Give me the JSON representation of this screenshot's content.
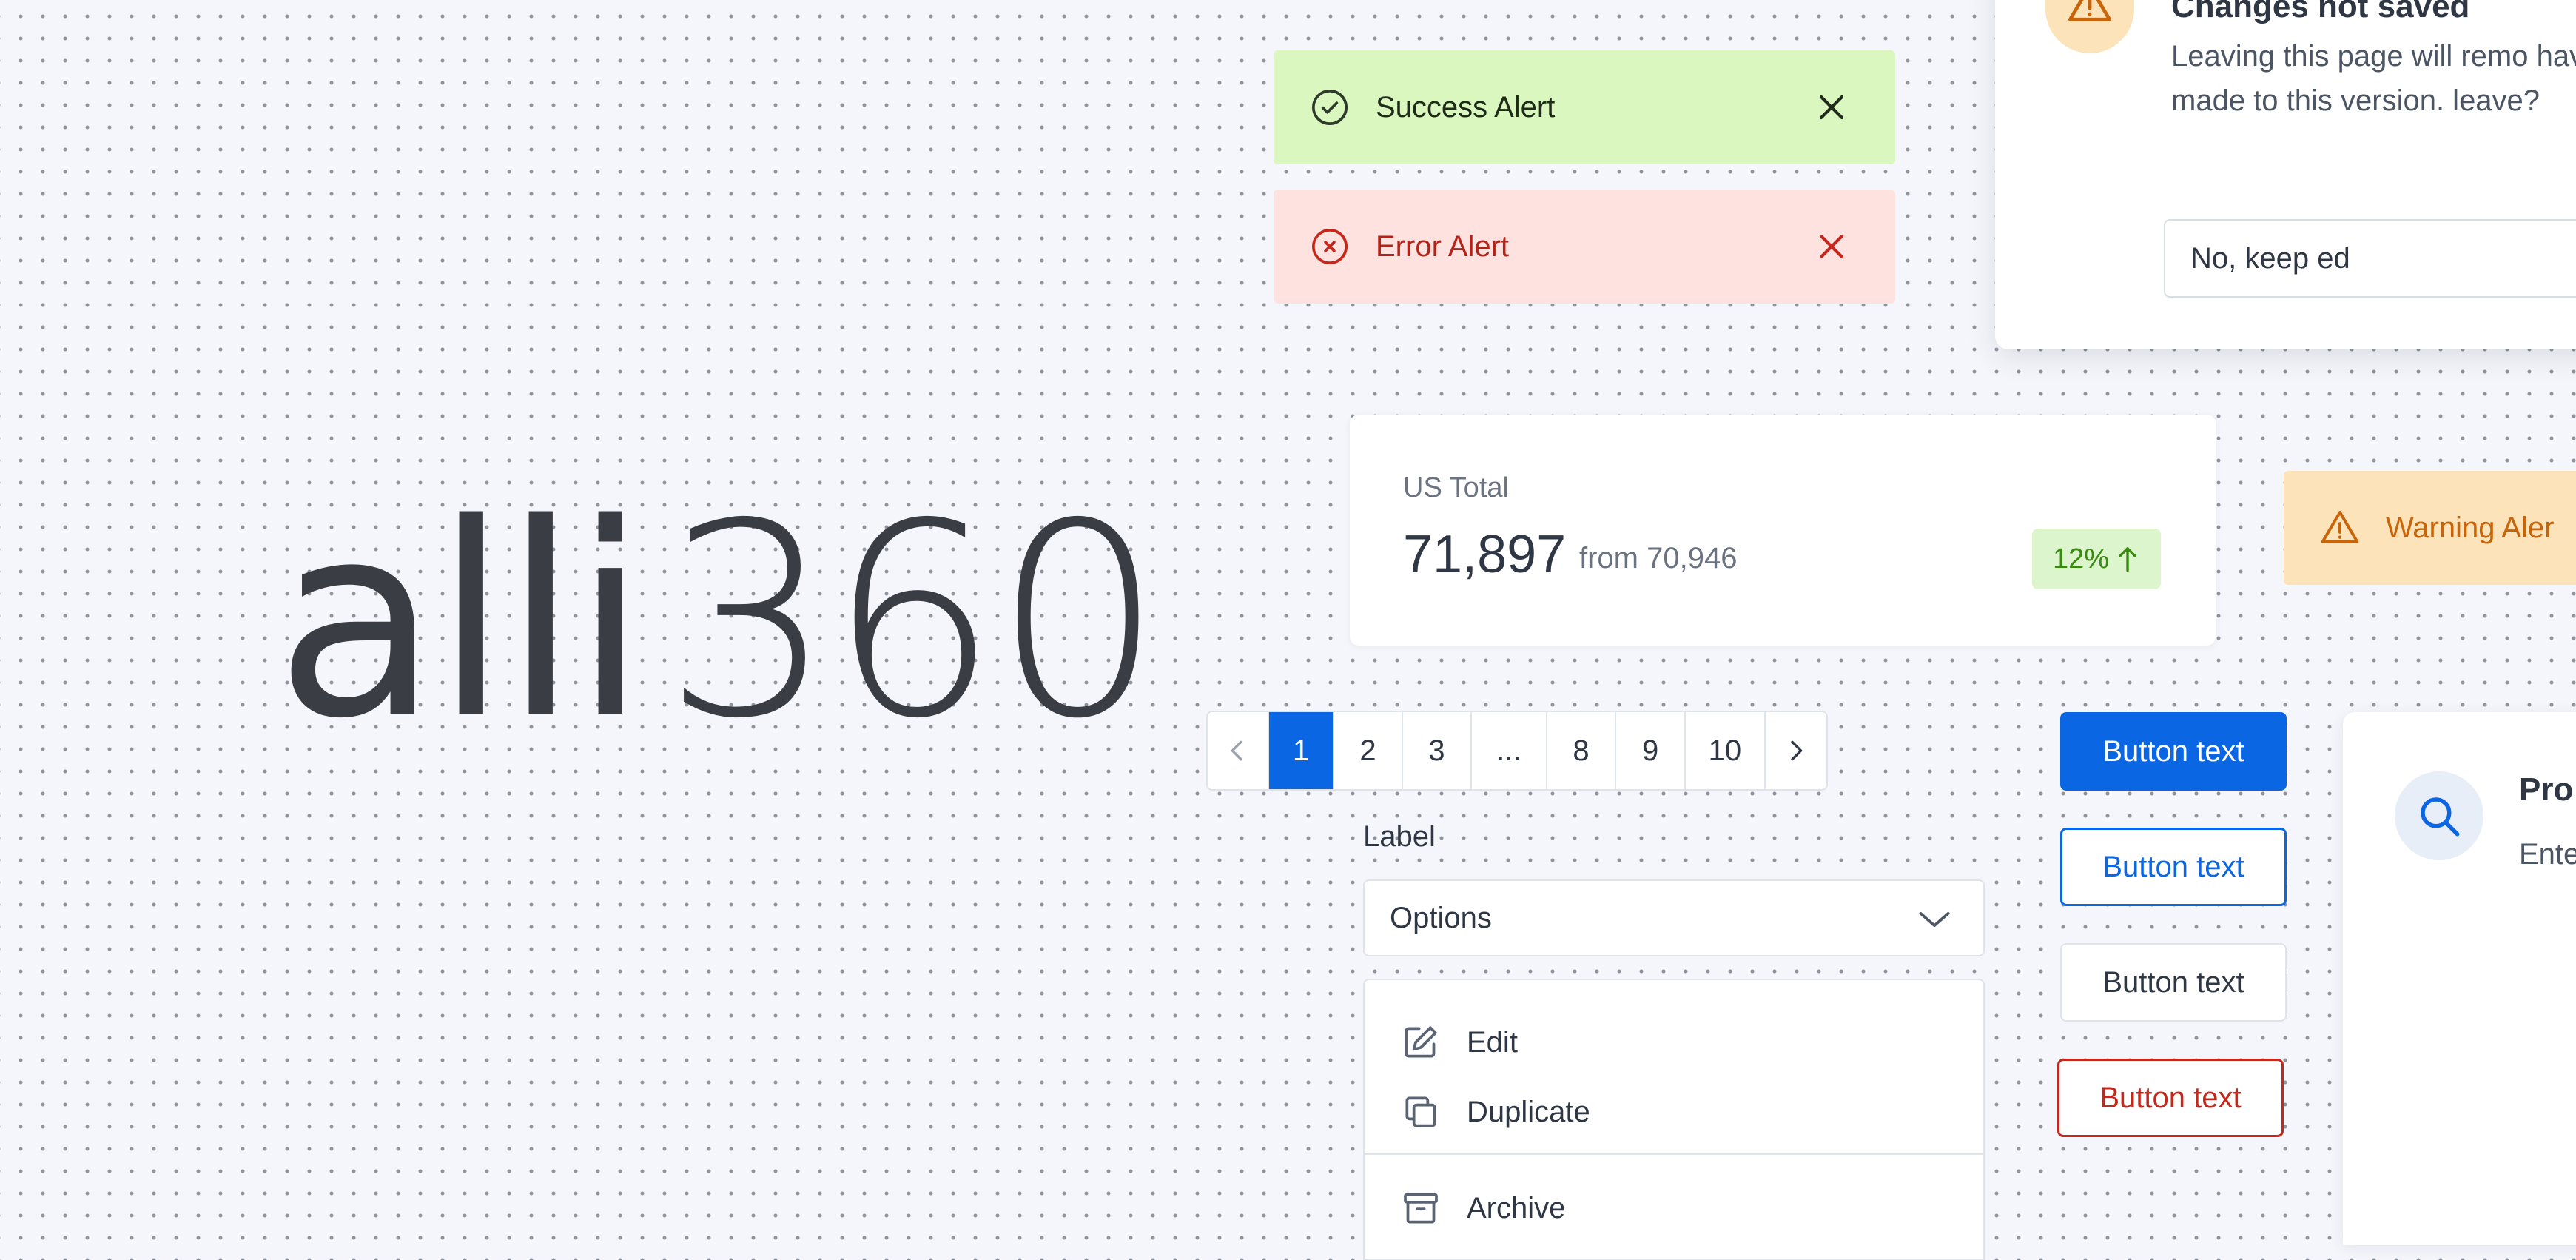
{
  "logo": {
    "word": "alli",
    "number": "360"
  },
  "alerts": {
    "success": {
      "text": "Success Alert",
      "icon": "check-circle-icon",
      "close_icon": "close-icon",
      "color": "#d9f7bf"
    },
    "error": {
      "text": "Error Alert",
      "icon": "x-circle-icon",
      "close_icon": "close-icon",
      "color": "#fde2df"
    },
    "warning": {
      "text": "Warning Aler",
      "icon": "warning-triangle-icon",
      "color": "#fde3b9"
    }
  },
  "modal": {
    "title": "Changes not saved",
    "body": "Leaving this page will remo have made to this version. leave?",
    "keep_button": "No, keep ed",
    "icon": "warning-triangle-icon"
  },
  "stat": {
    "label": "US Total",
    "value": "71,897",
    "from": "from 70,946",
    "change": "12%",
    "trend_icon": "arrow-up-icon",
    "trend_color": "#3a8a12"
  },
  "pagination": {
    "pages": [
      "1",
      "2",
      "3",
      "...",
      "8",
      "9",
      "10"
    ],
    "active": "1",
    "accent": "#0b66e4"
  },
  "field": {
    "label": "Label",
    "select_value": "Options"
  },
  "menu": {
    "items": [
      {
        "label": "Edit",
        "icon": "pencil-icon"
      },
      {
        "label": "Duplicate",
        "icon": "duplicate-icon"
      },
      {
        "label": "Archive",
        "icon": "archive-icon"
      }
    ]
  },
  "buttons": {
    "primary": "Button text",
    "outline": "Button text",
    "neutral": "Button text",
    "danger": "Button text"
  },
  "search_card": {
    "title": "Pro",
    "body": "Ente bar. mos as p",
    "icon": "search-icon"
  }
}
